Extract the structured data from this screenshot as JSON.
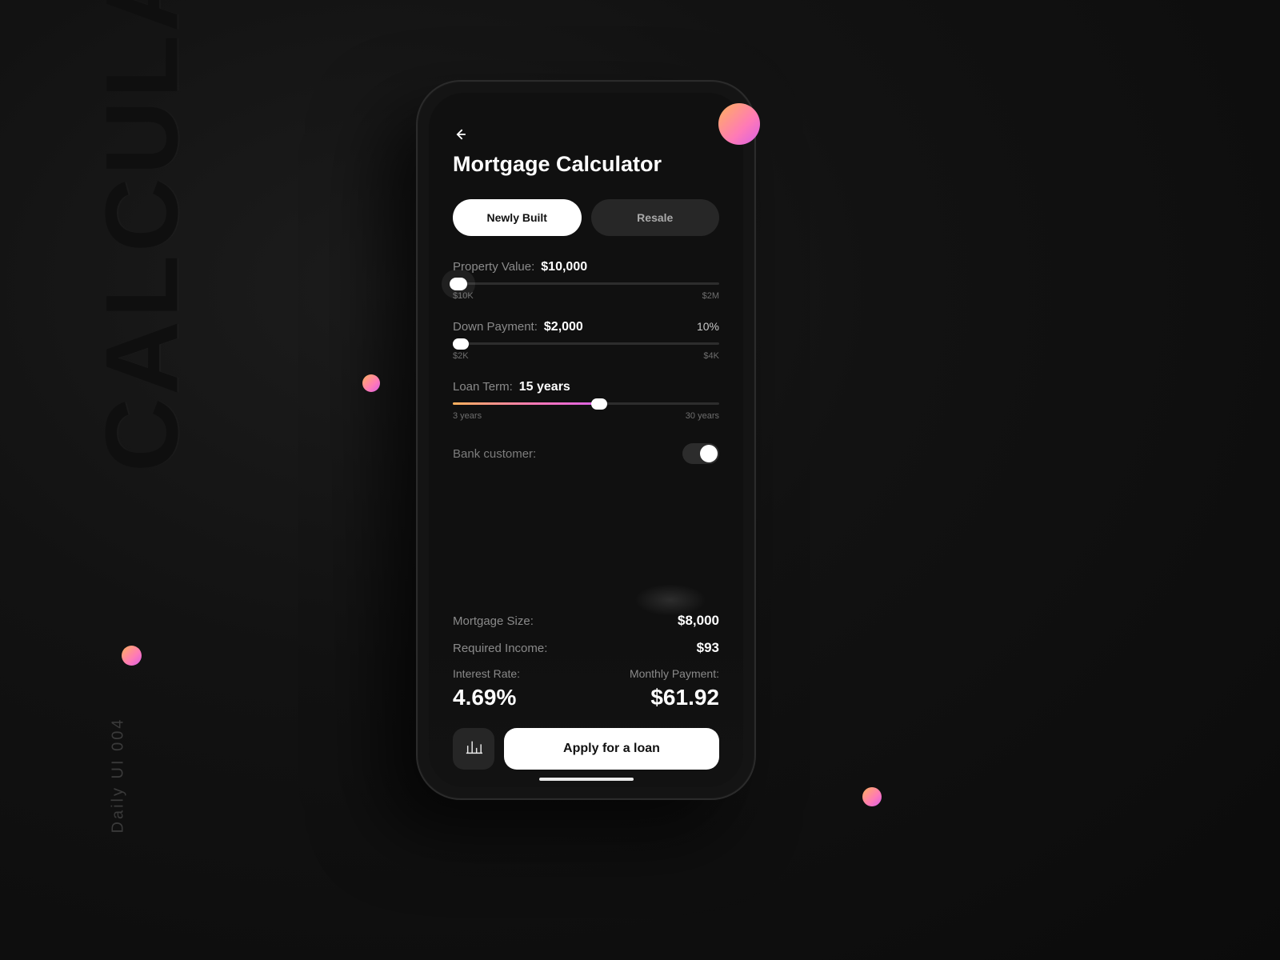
{
  "decorative": {
    "big_word": "CALCULATOR",
    "small_label": "Daily UI 004"
  },
  "header": {
    "title": "Mortgage Calculator"
  },
  "tabs": {
    "newly_built": "Newly Built",
    "resale": "Resale"
  },
  "property_value": {
    "label": "Property Value:",
    "value": "$10,000",
    "min_label": "$10K",
    "max_label": "$2M",
    "thumb_pct": 2
  },
  "down_payment": {
    "label": "Down Payment:",
    "value": "$2,000",
    "percent": "10%",
    "min_label": "$2K",
    "max_label": "$4K",
    "thumb_pct": 3
  },
  "loan_term": {
    "label": "Loan Term:",
    "value": "15 years",
    "min_label": "3 years",
    "max_label": "30 years",
    "thumb_pct": 55
  },
  "bank_customer": {
    "label": "Bank customer:"
  },
  "results": {
    "mortgage_size_label": "Mortgage Size:",
    "mortgage_size_value": "$8,000",
    "required_income_label": "Required Income:",
    "required_income_value": "$93",
    "interest_rate_label": "Interest Rate:",
    "interest_rate_value": "4.69%",
    "monthly_payment_label": "Monthly Payment:",
    "monthly_payment_value": "$61.92"
  },
  "cta": {
    "apply_label": "Apply for a loan"
  }
}
